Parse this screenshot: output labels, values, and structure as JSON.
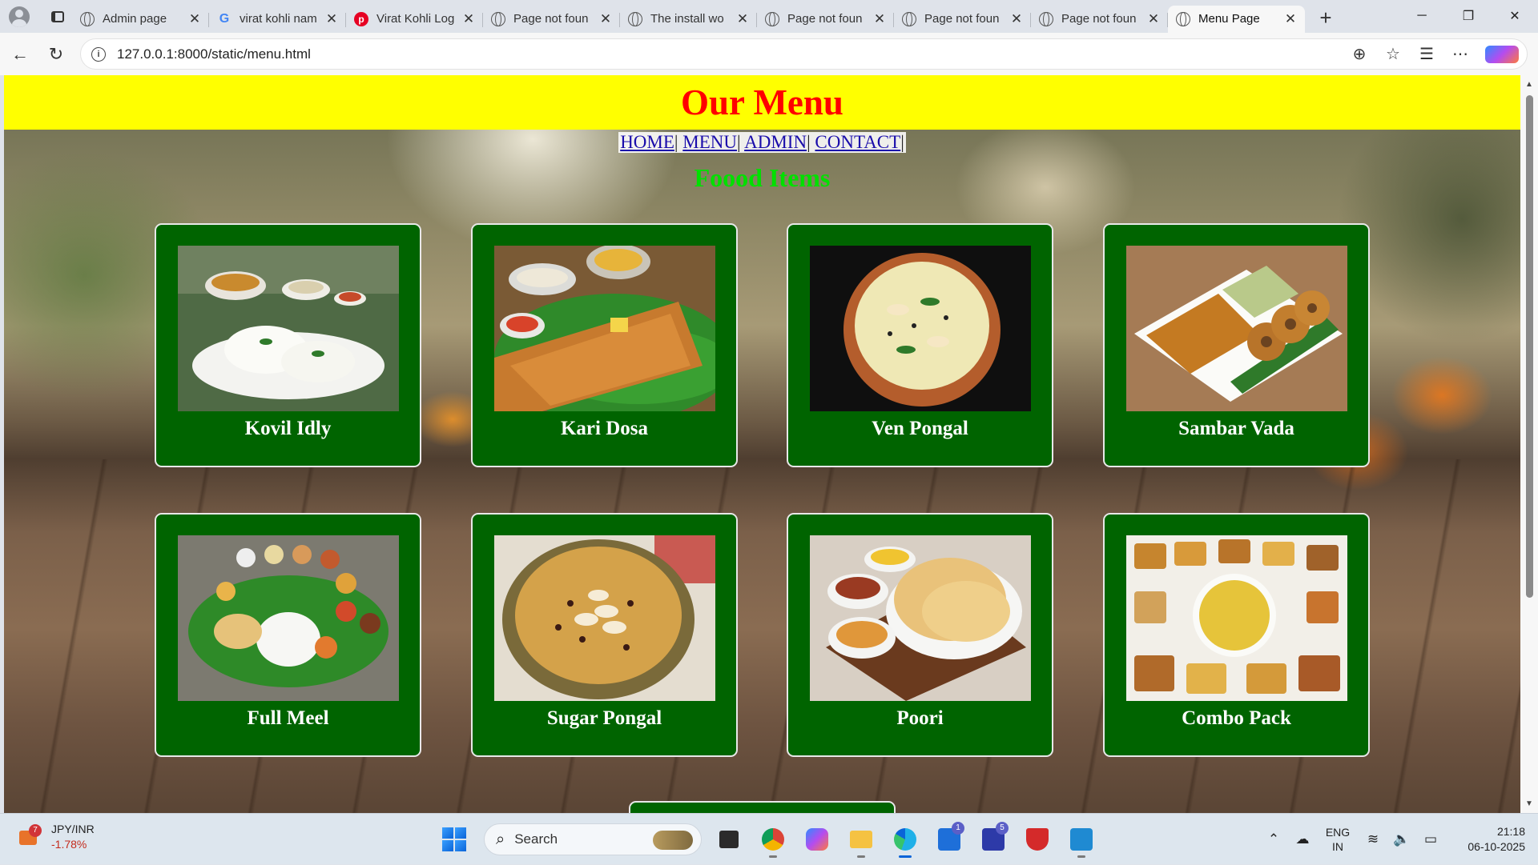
{
  "browser": {
    "tabs": [
      {
        "title": "Admin page",
        "icon": "globe-icon"
      },
      {
        "title": "virat kohli nam",
        "icon": "google-icon"
      },
      {
        "title": "Virat Kohli Log",
        "icon": "pinterest-icon"
      },
      {
        "title": "Page not foun",
        "icon": "globe-icon"
      },
      {
        "title": "The install wo",
        "icon": "globe-icon"
      },
      {
        "title": "Page not foun",
        "icon": "globe-icon"
      },
      {
        "title": "Page not foun",
        "icon": "globe-icon"
      },
      {
        "title": "Page not foun",
        "icon": "globe-icon"
      },
      {
        "title": "Menu Page",
        "icon": "globe-icon",
        "active": true
      }
    ],
    "url": "127.0.0.1:8000/static/menu.html"
  },
  "page": {
    "banner_title": "Our Menu",
    "nav": [
      "HOME",
      "MENU",
      "ADMIN",
      "CONTACT"
    ],
    "nav_sep": "|",
    "section_title": "Foood Items",
    "items": [
      {
        "name": "Kovil Idly",
        "image": "idly-plate-image"
      },
      {
        "name": "Kari Dosa",
        "image": "dosa-banana-leaf-image"
      },
      {
        "name": "Ven Pongal",
        "image": "pongal-bowl-image"
      },
      {
        "name": "Sambar Vada",
        "image": "vada-sambar-image"
      },
      {
        "name": "Full Meel",
        "image": "meals-banana-leaf-image"
      },
      {
        "name": "Sugar Pongal",
        "image": "sweet-pongal-image"
      },
      {
        "name": "Poori",
        "image": "poori-masala-image"
      },
      {
        "name": "Combo Pack",
        "image": "snack-combo-image"
      }
    ],
    "colors": {
      "banner": "#ffff00",
      "title": "#ff0000",
      "section": "#00e000",
      "card": "#006400"
    }
  },
  "taskbar": {
    "widget_title": "JPY/INR",
    "widget_value": "-1.78%",
    "widget_badge": "7",
    "search_placeholder": "Search",
    "lang_top": "ENG",
    "lang_bottom": "IN",
    "time": "21:18",
    "date": "06-10-2025",
    "badge_store": "1",
    "badge_l": "5"
  }
}
